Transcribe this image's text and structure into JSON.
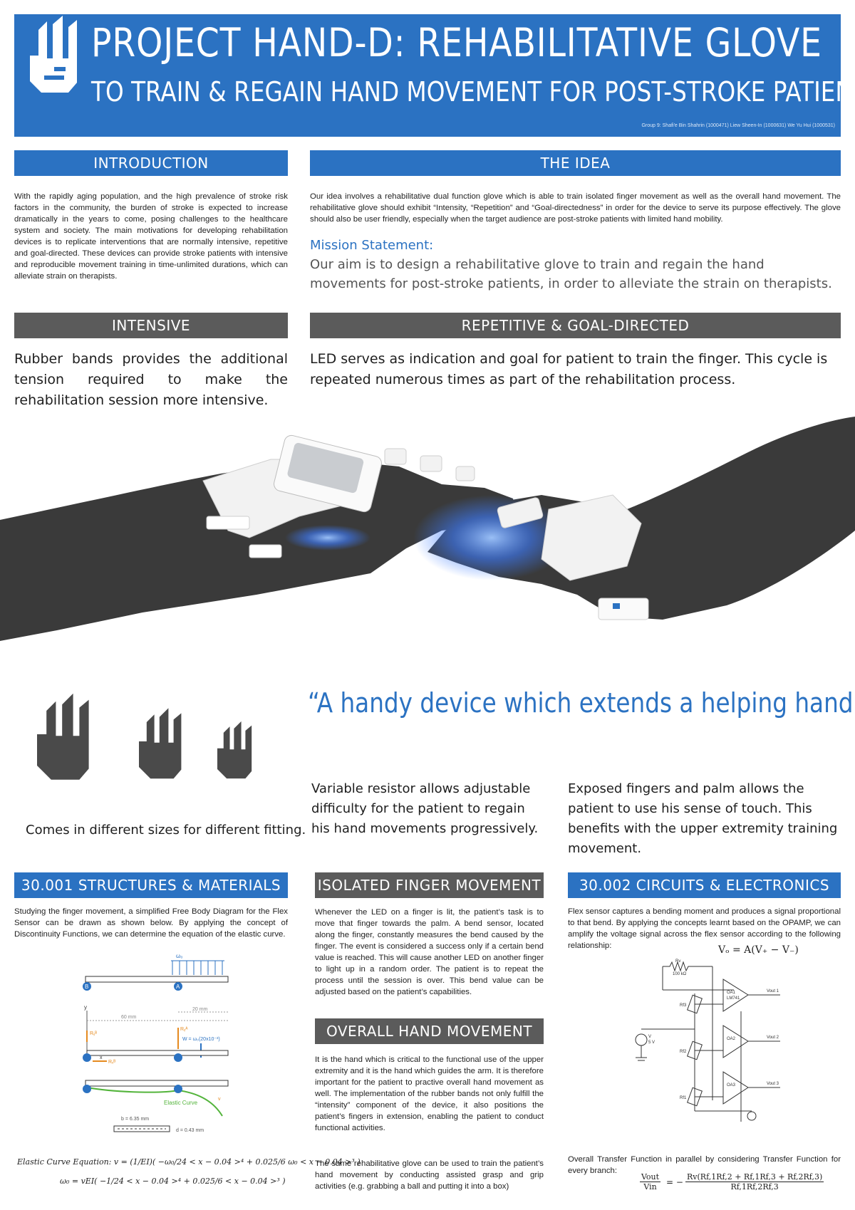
{
  "header": {
    "title": "PROJECT HAND-D: REHABILITATIVE GLOVE",
    "subtitle": "TO TRAIN & REGAIN HAND MOVEMENT FOR POST-STROKE PATIENTS",
    "credits": "Group 9: Shafi'e Bin Shahrin (1000471) Liew Sheen-In (1000631) We Yu Hui (1000531)"
  },
  "colors": {
    "accent": "#2b72c2",
    "section_gray": "#5b5b5b",
    "glove_glow": "#3d7cff"
  },
  "introduction": {
    "title": "INTRODUCTION",
    "body": "With the rapidly aging population, and the high prevalence of stroke risk factors in the community, the burden of stroke is expected to increase dramatically in the years to come, posing challenges to the healthcare system and society. The main motivations for developing rehabilitation devices is to replicate interventions that are normally intensive, repetitive and goal-directed. These devices can provide stroke patients with intensive and reproducible movement training in time-unlimited durations, which can alleviate strain on therapists."
  },
  "idea": {
    "title": "THE IDEA",
    "body": "Our idea involves a rehabilitative dual function glove which is able to train isolated finger movement as well as the overall hand movement. The rehabilitative glove should exhibit “Intensity, “Repetition” and “Goal-directedness” in order for the device to serve its purpose effectively. The glove should also be user friendly, especially when the target audience are post-stroke patients with limited hand mobility.",
    "mission_title": "Mission Statement:",
    "mission": "Our aim is to design a rehabilitative glove to train and regain the hand movements for post-stroke patients, in order to alleviate the strain on therapists."
  },
  "intensive": {
    "title": "INTENSIVE",
    "body": "Rubber bands provides the additional tension required to make the rehabilitation session more intensive."
  },
  "repetitive": {
    "title": "REPETITIVE & GOAL-DIRECTED",
    "body": "LED serves as indication and goal for patient to train the finger. This cycle is repeated numerous times as part of the rehabilitation process."
  },
  "quote": "“A handy device which extends a helping hand...”",
  "sizes_caption": "Comes in different sizes for different fitting.",
  "variable_resistor": "Variable resistor allows adjustable difficulty for the patient to regain his hand movements progressively.",
  "exposed_fingers": "Exposed fingers and palm allows the patient to use his sense of touch. This benefits with the upper extremity training movement.",
  "structures": {
    "title": "30.001 STRUCTURES & MATERIALS",
    "body": "Studying the finger movement, a simplified Free Body Diagram for the Flex Sensor can be drawn as shown below. By applying the concept of Discontinuity Functions, we can determine the equation of the elastic curve.",
    "labels": {
      "omega": "ω₀",
      "y": "y",
      "x": "x",
      "b": "B",
      "a": "A",
      "dim_60": "60 mm",
      "dim_20": "20 mm",
      "ra_y": "Rᵧᴬ",
      "rb_y": "Rᵧᴮ",
      "rb_x": "Rₓᴮ",
      "w": "W = ω₀(20x10⁻³)",
      "v": "v",
      "elastic": "Elastic Curve",
      "b_width": "b = 6.35 mm",
      "d_thick": "d = 0.43 mm"
    },
    "eq1": "Elastic Curve Equation: v = (1/EI)( −ω₀/24 < x − 0.04 >⁴ + 0.025/6 ω₀ < x − 0.04 >³ )",
    "eq2": "ω₀ = vEI( −1/24 < x − 0.04 >⁴ + 0.025/6 < x − 0.04 >³ )"
  },
  "isolated": {
    "title": "ISOLATED FINGER MOVEMENT",
    "body": "Whenever the LED on a finger is lit, the patient’s task is to move that finger towards the palm. A bend sensor, located along the finger, constantly measures the bend caused by the finger. The event is considered a success only if a certain bend value is reached. This will cause another LED on another finger to light up in a random order. The patient is to repeat the process until the session is over. This bend value can be adjusted based on the patient’s capabilities."
  },
  "overall": {
    "title": "OVERALL HAND MOVEMENT",
    "body1": "It is the hand which is critical to the functional use of the upper extremity and it is the hand which guides the arm. It is therefore important for the patient to practive overall hand movement as well. The implementation of the rubber bands not only fulfill the “intensity” component of the device, it also positions the patient’s fingers in extension, enabling the patient to conduct functional activities.",
    "body2": "The same rehabilitative glove can be used to train the patient’s hand movement by conducting assisted grasp and grip activities (e.g. grabbing a ball and putting it into a box)"
  },
  "circuits": {
    "title": "30.002 CIRCUITS & ELECTRONICS",
    "body": "Flex sensor captures a bending moment and produces a signal proportional to that bend. By applying the concepts learnt based on the OPAMP, we can amplify the voltage signal across the flex sensor according to the following relationship:",
    "eq_gain": "Vₒ = A(V₊ − V₋)",
    "labels": {
      "rv": "Rv",
      "rv_val": "100 kΩ",
      "rf1": "Rf1",
      "rf2": "Rf2",
      "rf3": "Rf3",
      "oa1": "OA1",
      "oa2": "OA2",
      "oa3": "OA3",
      "lm": "LM741",
      "vout1": "Vout 1",
      "vout2": "Vout 2",
      "vout3": "Vout 3",
      "v": "V",
      "v5": "5 V"
    },
    "transfer_text": "Overall Transfer Function in parallel by considering Transfer Function for every branch:",
    "transfer_lhs_num": "Vout",
    "transfer_lhs_den": "Vin",
    "transfer_num": "Rv(Rf,1Rf,2 + Rf,1Rf,3 + Rf,2Rf,3)",
    "transfer_den": "Rf,1Rf,2Rf,3"
  }
}
